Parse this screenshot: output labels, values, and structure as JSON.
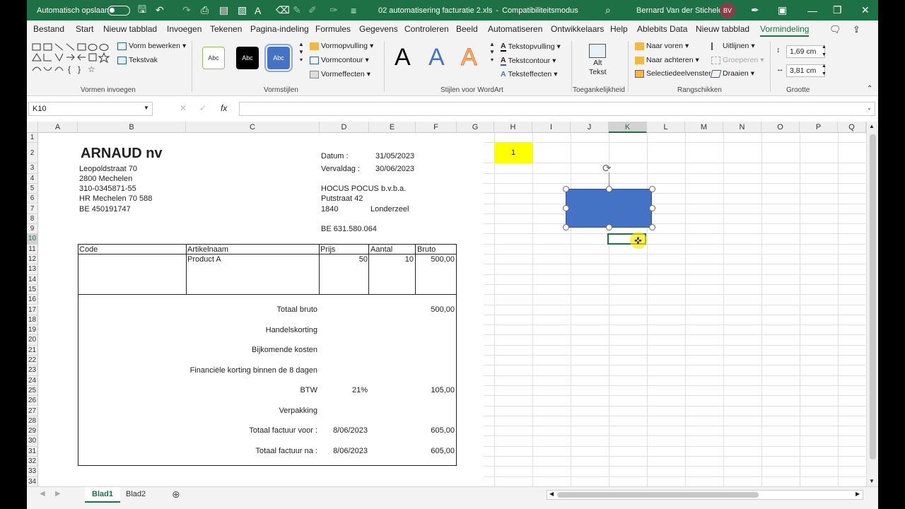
{
  "titlebar": {
    "autosave_label": "Automatisch opslaan",
    "filename": "02 automatisering facturatie 2.xls",
    "separator": "-",
    "mode": "Compatibiliteitsmodus",
    "user": "Bernard Van der Stichelen",
    "user_initials": "BV"
  },
  "menu": [
    "Bestand",
    "Start",
    "Nieuw tabblad",
    "Invoegen",
    "Tekenen",
    "Pagina-indeling",
    "Formules",
    "Gegevens",
    "Controleren",
    "Beeld",
    "Automatiseren",
    "Ontwikkelaars",
    "Help",
    "Ablebits Data",
    "Nieuw tabblad",
    "Vormindeling"
  ],
  "ribbon": {
    "vorm_bewerken": "Vorm bewerken",
    "tekstvak": "Tekstvak",
    "group_vormen": "Vormen invoegen",
    "style_sample": "Abc",
    "vormopvulling": "Vormopvulling",
    "vormcontour": "Vormcontour",
    "vormeffecten": "Vormeffecten",
    "group_vormstijlen": "Vormstijlen",
    "wordart_letter": "A",
    "tekstopvulling": "Tekstopvulling",
    "tekstcontour": "Tekstcontour",
    "teksteffecten": "Teksteffecten",
    "group_wordart": "Stijlen voor WordArt",
    "alt_tekst": "Alt",
    "alt_tekst2": "Tekst",
    "group_toegankelijkheid": "Toegankelijkheid",
    "naar_voren": "Naar voren",
    "naar_achteren": "Naar achteren",
    "selectiedeelvenster": "Selectiedeelvenster",
    "uitlijnen": "Uitlijnen",
    "groeperen": "Groeperen",
    "draaien": "Draaien",
    "group_rangschikken": "Rangschikken",
    "height": "1,69 cm",
    "width": "3,81 cm",
    "group_grootte": "Grootte"
  },
  "namebox": "K10",
  "fx": "fx",
  "columns": [
    "A",
    "B",
    "C",
    "D",
    "E",
    "F",
    "G",
    "H",
    "I",
    "J",
    "K",
    "L",
    "M",
    "N",
    "O",
    "P",
    "Q"
  ],
  "rows": [
    "1",
    "2",
    "3",
    "4",
    "5",
    "6",
    "7",
    "8",
    "9",
    "10",
    "11",
    "12",
    "13",
    "14",
    "15",
    "16",
    "17",
    "18",
    "19",
    "20",
    "21",
    "22",
    "23",
    "24",
    "25",
    "26",
    "27",
    "28",
    "29",
    "30",
    "31",
    "32",
    "33",
    "34"
  ],
  "invoice": {
    "company": "ARNAUD nv",
    "addr1": "Leopoldstraat 70",
    "addr2": "2800 Mechelen",
    "phone": "310-0345871-55",
    "hr": "HR Mechelen 70 588",
    "vat": "BE 450191747",
    "datum_label": "Datum :",
    "datum": "31/05/2023",
    "vervaldag_label": "Vervaldag :",
    "vervaldag": "30/06/2023",
    "client": "HOCUS POCUS b.v.b.a.",
    "client_street": "Putstraat 42",
    "client_zip": "1840",
    "client_city": "Londerzeel",
    "client_vat": "BE 631.580.064",
    "hdr_code": "Code",
    "hdr_artikel": "Artikelnaam",
    "hdr_prijs": "Prijs",
    "hdr_aantal": "Aantal",
    "hdr_bruto": "Bruto",
    "item_name": "Product A",
    "item_prijs": "50",
    "item_aantal": "10",
    "item_bruto": "500,00",
    "totaal_bruto_label": "Totaal bruto",
    "totaal_bruto": "500,00",
    "handelskorting": "Handelskorting",
    "bijkomende": "Bijkomende kosten",
    "financiele": "Financiële korting binnen de 8 dagen",
    "btw_label": "BTW",
    "btw_pct": "21%",
    "btw": "105,00",
    "verpakking": "Verpakking",
    "voor_label": "Totaal factuur voor :",
    "voor_date": "8/06/2023",
    "voor_amount": "605,00",
    "na_label": "Totaal factuur na :",
    "na_date": "8/06/2023",
    "na_amount": "605,00"
  },
  "h2_value": "1",
  "sheets": [
    "Blad1",
    "Blad2"
  ],
  "colors": {
    "excel_green": "#1e7145",
    "shape_fill": "#4472c4",
    "highlight_yellow": "#ffff00"
  }
}
